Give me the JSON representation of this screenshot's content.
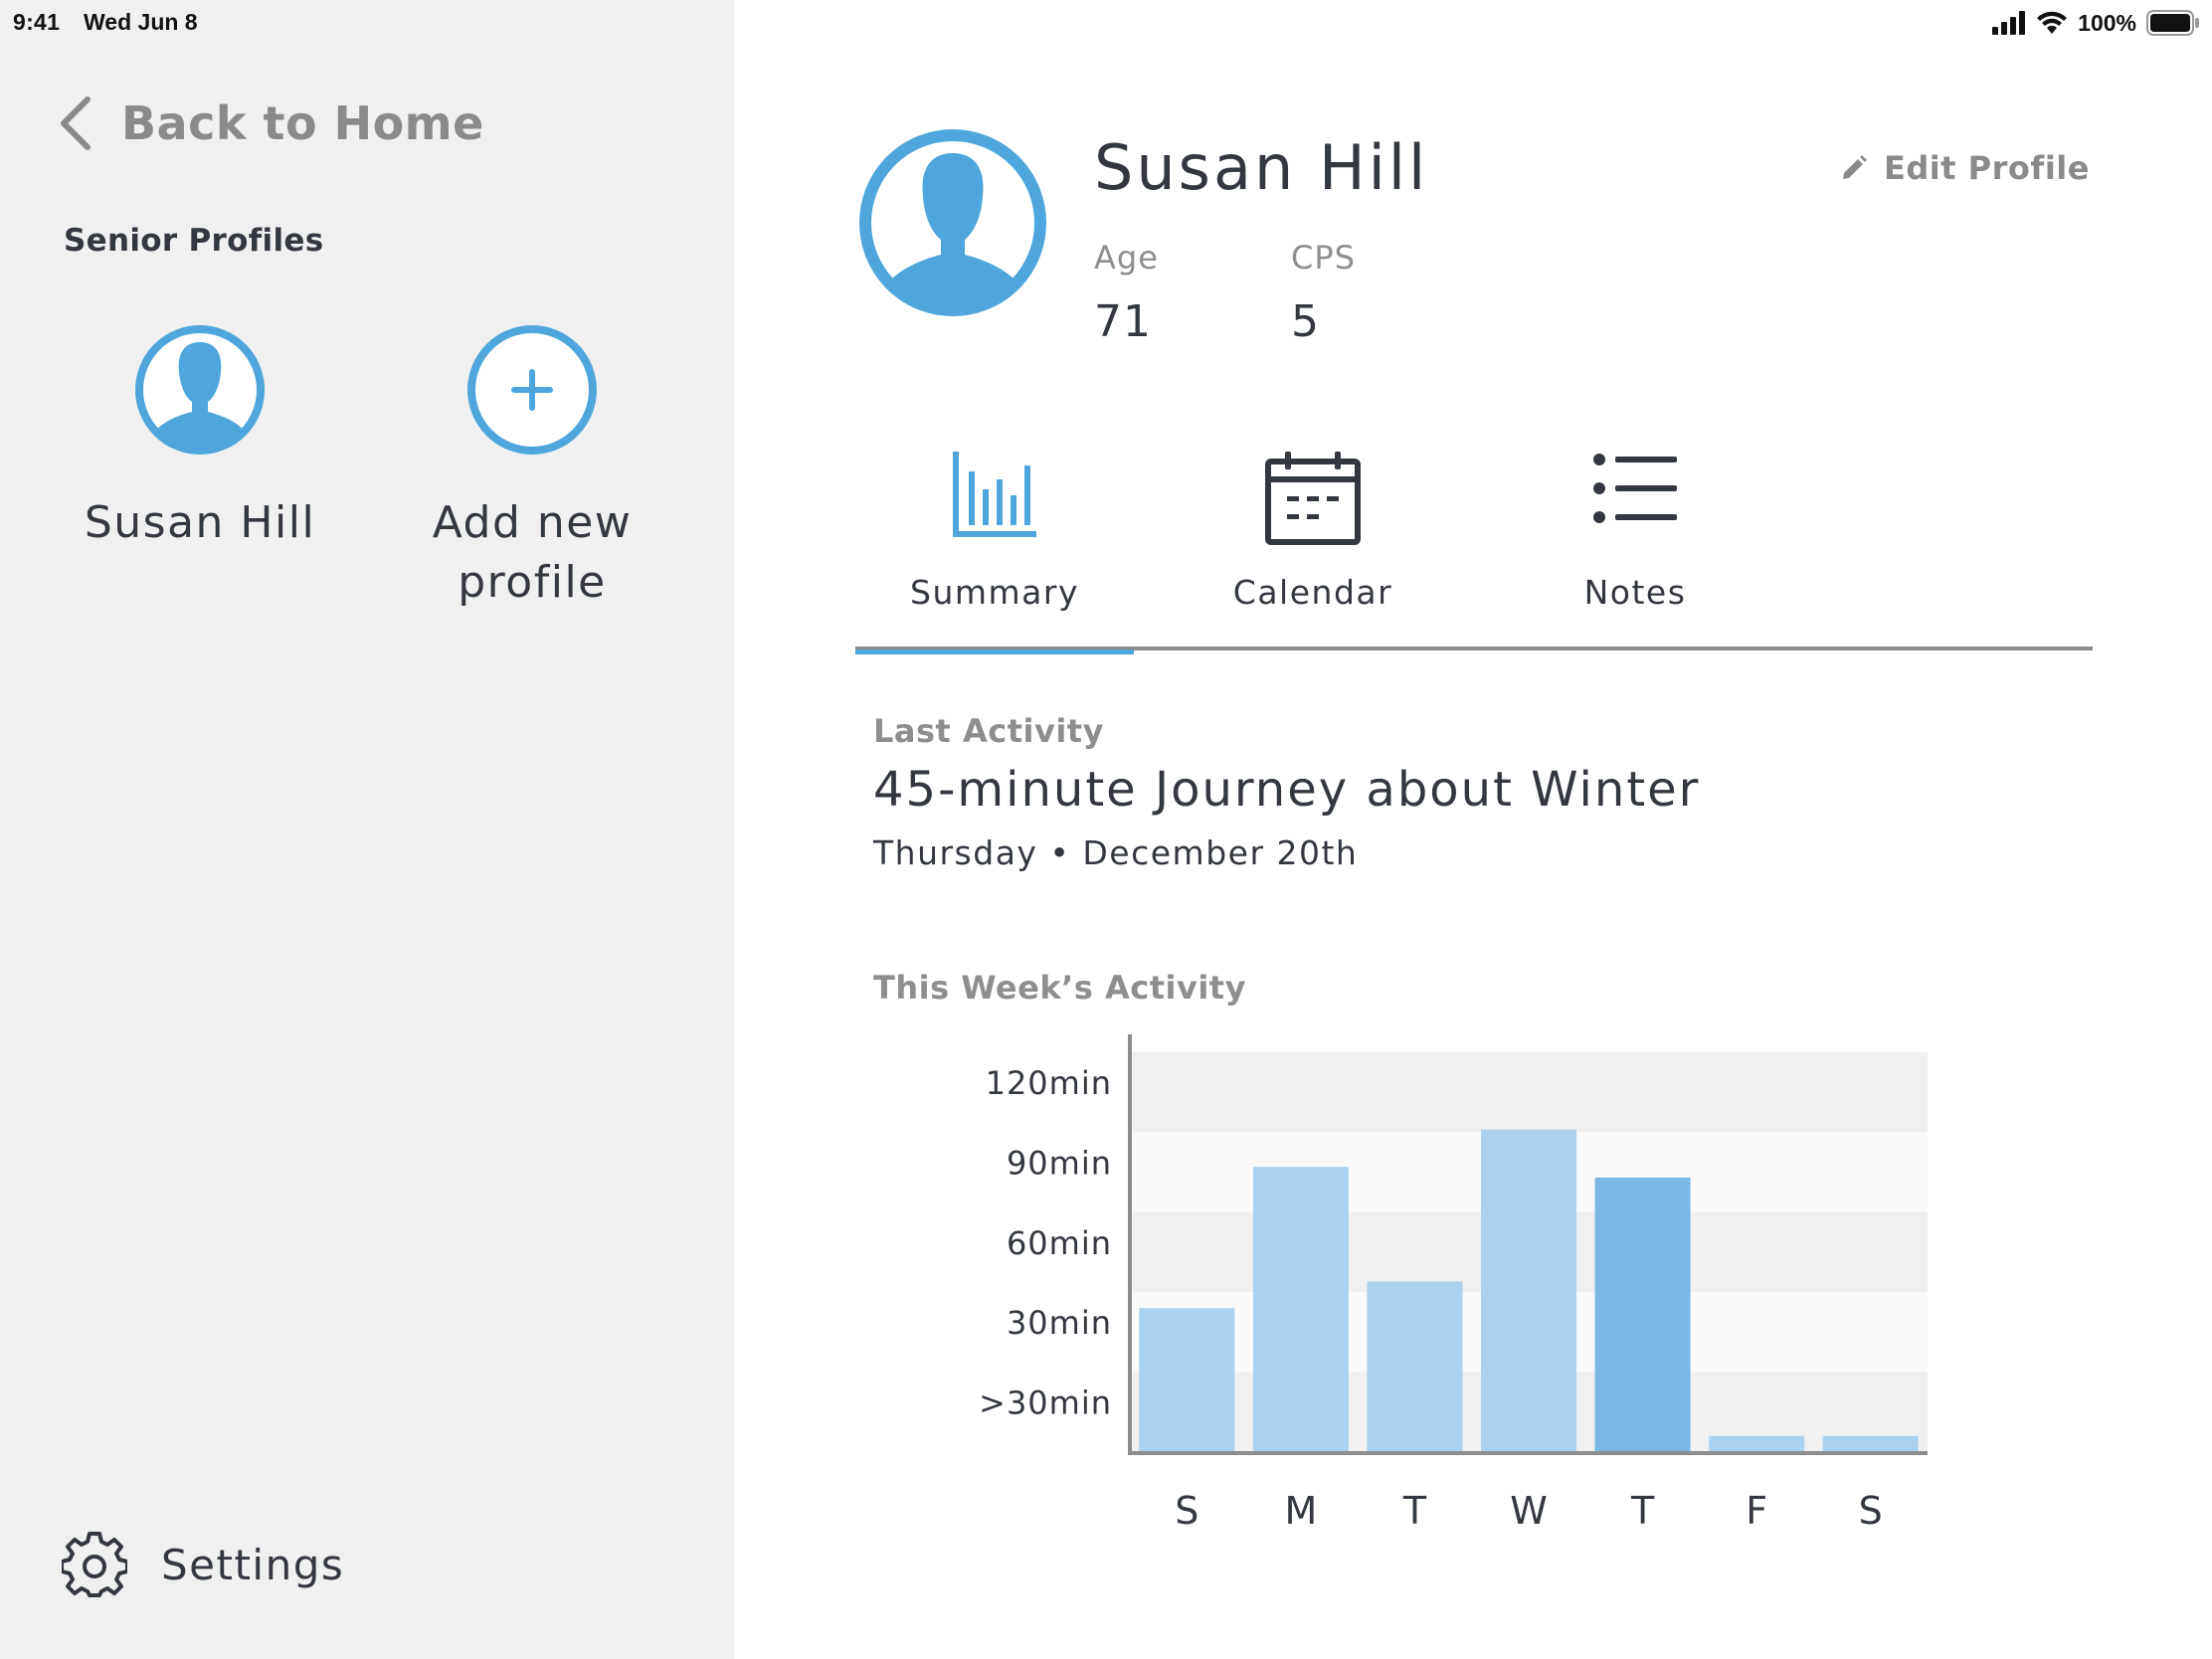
{
  "status_bar": {
    "time": "9:41",
    "date": "Wed Jun 8",
    "battery": "100%"
  },
  "sidebar": {
    "back_label": "Back to Home",
    "section_title": "Senior Profiles",
    "profiles": [
      {
        "name": "Susan Hill"
      },
      {
        "name_line1": "Add new",
        "name_line2": "profile"
      }
    ],
    "settings_label": "Settings"
  },
  "profile": {
    "name": "Susan Hill",
    "edit_label": "Edit Profile",
    "age_label": "Age",
    "age_value": "71",
    "cps_label": "CPS",
    "cps_value": "5"
  },
  "tabs": [
    {
      "label": "Summary",
      "icon": "bar-chart-icon",
      "active": true
    },
    {
      "label": "Calendar",
      "icon": "calendar-icon",
      "active": false
    },
    {
      "label": "Notes",
      "icon": "list-icon",
      "active": false
    }
  ],
  "last_activity": {
    "label": "Last Activity",
    "title": "45-minute Journey about Winter",
    "date": "Thursday • December 20th"
  },
  "week_activity_label": "This Week’s Activity",
  "colors": {
    "accent": "#4ea6dd",
    "sidebar_bg": "#f0f0f0",
    "bar_light": "#aad1ef",
    "bar_highlight": "#7ab8e3",
    "text_dark": "#333740",
    "text_muted": "#8e8e8e"
  },
  "chart_data": {
    "type": "bar",
    "categories": [
      "S",
      "M",
      "T",
      "W",
      "T",
      "F",
      "S"
    ],
    "y_tick_labels": [
      ">30min",
      "30min",
      "60min",
      "90min",
      "120min"
    ],
    "values": [
      54,
      107,
      64,
      121,
      103,
      6,
      6
    ],
    "highlight_index": 4,
    "ylim": [
      0,
      150
    ],
    "grid": "banded rows",
    "title": "",
    "xlabel": "",
    "ylabel": ""
  }
}
